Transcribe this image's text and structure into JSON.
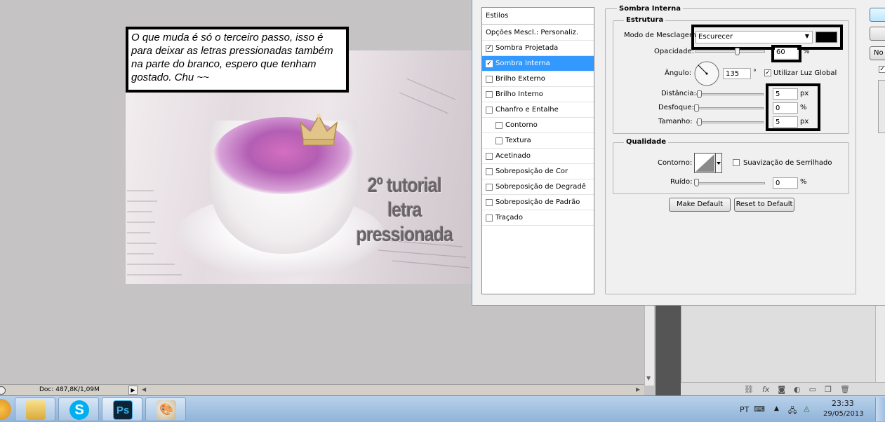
{
  "note": {
    "text": "O que muda é só o terceiro passo, isso é para deixar as letras pressionadas também na parte do branco, espero que tenham gostado. Chu ~~"
  },
  "canvas": {
    "overlay_line1": "2º tutorial",
    "overlay_line2": "letra",
    "overlay_line3": "pressionada"
  },
  "status": {
    "doc": "Doc: 487,8K/1,09M"
  },
  "styles_list": {
    "header": "Estilos",
    "items": [
      {
        "label": "Opções Mescl.: Personaliz.",
        "checkbox": false,
        "checked": false,
        "selected": false,
        "indent": false
      },
      {
        "label": "Sombra Projetada",
        "checkbox": true,
        "checked": true,
        "selected": false,
        "indent": false
      },
      {
        "label": "Sombra Interna",
        "checkbox": true,
        "checked": true,
        "selected": true,
        "indent": false
      },
      {
        "label": "Brilho Externo",
        "checkbox": true,
        "checked": false,
        "selected": false,
        "indent": false
      },
      {
        "label": "Brilho Interno",
        "checkbox": true,
        "checked": false,
        "selected": false,
        "indent": false
      },
      {
        "label": "Chanfro e Entalhe",
        "checkbox": true,
        "checked": false,
        "selected": false,
        "indent": false
      },
      {
        "label": "Contorno",
        "checkbox": true,
        "checked": false,
        "selected": false,
        "indent": true
      },
      {
        "label": "Textura",
        "checkbox": true,
        "checked": false,
        "selected": false,
        "indent": true
      },
      {
        "label": "Acetinado",
        "checkbox": true,
        "checked": false,
        "selected": false,
        "indent": false
      },
      {
        "label": "Sobreposição de Cor",
        "checkbox": true,
        "checked": false,
        "selected": false,
        "indent": false
      },
      {
        "label": "Sobreposição de Degradê",
        "checkbox": true,
        "checked": false,
        "selected": false,
        "indent": false
      },
      {
        "label": "Sobreposição de Padrão",
        "checkbox": true,
        "checked": false,
        "selected": false,
        "indent": false
      },
      {
        "label": "Traçado",
        "checkbox": true,
        "checked": false,
        "selected": false,
        "indent": false
      }
    ]
  },
  "inner_shadow": {
    "title": "Sombra Interna",
    "structure_title": "Estrutura",
    "blend_mode_label": "Modo de Mesclagem:",
    "blend_mode_value": "Escurecer",
    "blend_color": "#000000",
    "opacity_label": "Opacidade:",
    "opacity_value": "60",
    "opacity_unit": "%",
    "opacity_level": 0.6,
    "angle_label": "Ângulo:",
    "angle_value": "135",
    "angle_unit": "°",
    "global_light_label": "Utilizar Luz Global",
    "global_light_checked": true,
    "distance_label": "Distância:",
    "distance_value": "5",
    "distance_unit": "px",
    "choke_label": "Desfoque:",
    "choke_value": "0",
    "choke_unit": "%",
    "size_label": "Tamanho:",
    "size_value": "5",
    "size_unit": "px"
  },
  "quality": {
    "title": "Qualidade",
    "contour_label": "Contorno:",
    "anti_alias_label": "Suavização de Serrilhado",
    "noise_label": "Ruído:",
    "noise_value": "0",
    "noise_unit": "%"
  },
  "buttons": {
    "make_default": "Make Default",
    "reset_default": "Reset to Default",
    "right_partial": "No"
  },
  "tray": {
    "lang": "PT",
    "time": "23:33",
    "date": "29/05/2013"
  },
  "colors": {
    "selection": "#3399ff",
    "taskbar": "#a9c6e4"
  }
}
